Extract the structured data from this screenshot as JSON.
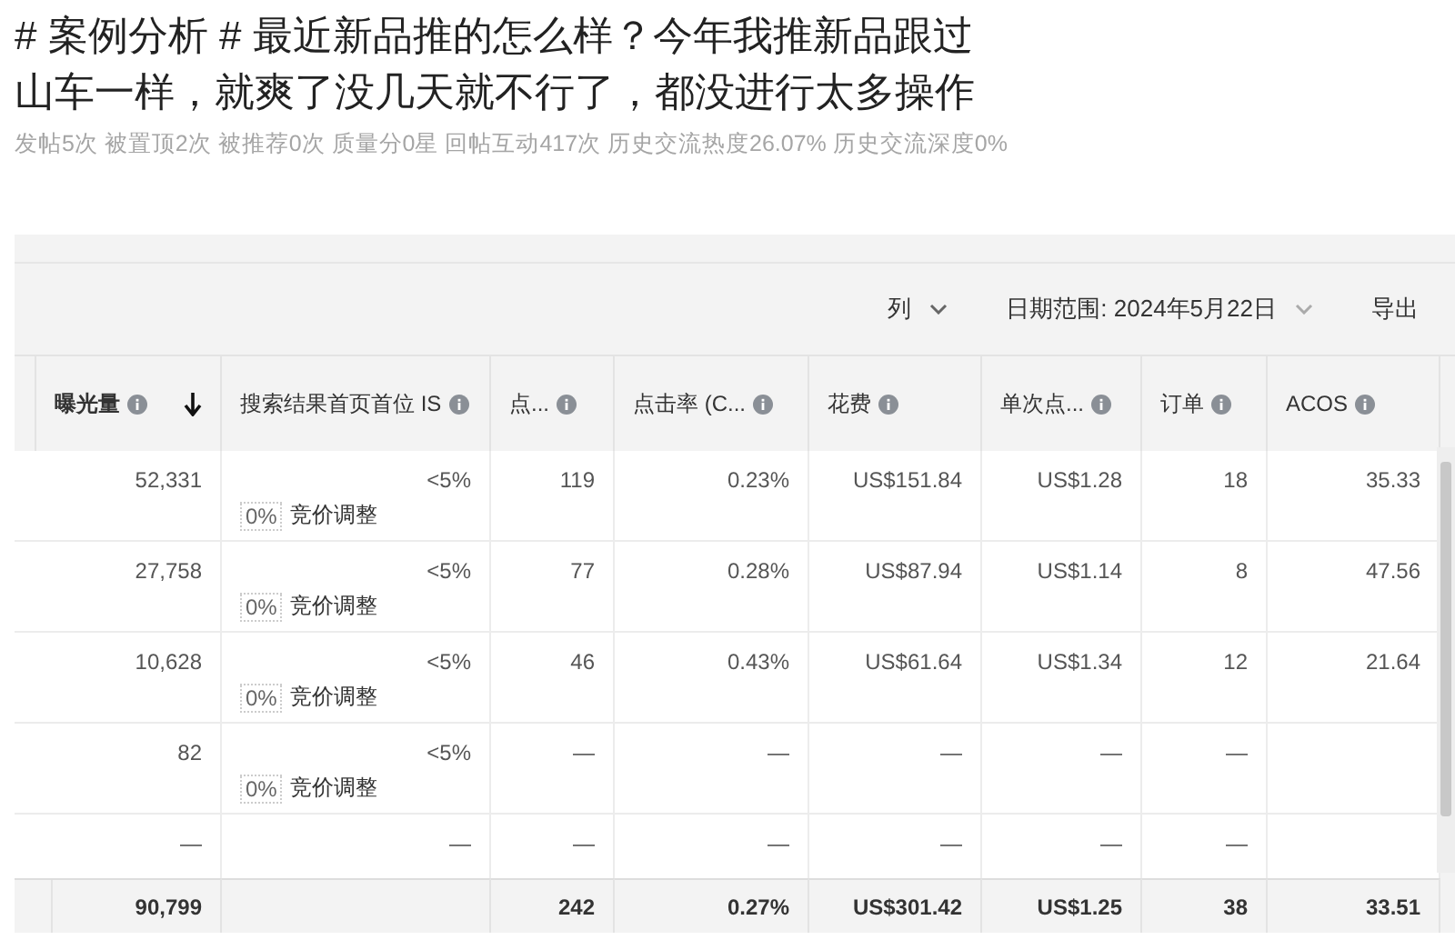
{
  "post": {
    "title_lines": [
      "# 案例分析 # 最近新品推的怎么样？今年我推新品跟过",
      "山车一样，就爽了没几天就不行了，都没进行太多操作"
    ],
    "meta": "发帖5次 被置顶2次 被推荐0次 质量分0星 回帖互动417次 历史交流热度26.07% 历史交流深度0%"
  },
  "toolbar": {
    "columns_button": "列",
    "date_range": "日期范围: 2024年5月22日",
    "export": "导出"
  },
  "table": {
    "columns": [
      {
        "label": "曝光量",
        "sorted": true,
        "kind": "metric"
      },
      {
        "label": "搜索结果首页首位 IS",
        "sorted": false,
        "kind": "share"
      },
      {
        "label": "点...",
        "sorted": false
      },
      {
        "label": "点击率 (C...",
        "sorted": false
      },
      {
        "label": "花费",
        "sorted": false
      },
      {
        "label": "单次点...",
        "sorted": false
      },
      {
        "label": "订单",
        "sorted": false
      },
      {
        "label": "ACOS",
        "sorted": false
      }
    ],
    "rows": [
      {
        "cells": [
          "52,331",
          "<5%",
          "119",
          "0.23%",
          "US$151.84",
          "US$1.28",
          "18",
          "35.33"
        ],
        "bid": {
          "value": "0%",
          "label": "竞价调整"
        }
      },
      {
        "cells": [
          "27,758",
          "<5%",
          "77",
          "0.28%",
          "US$87.94",
          "US$1.14",
          "8",
          "47.56"
        ],
        "bid": {
          "value": "0%",
          "label": "竞价调整"
        }
      },
      {
        "cells": [
          "10,628",
          "<5%",
          "46",
          "0.43%",
          "US$61.64",
          "US$1.34",
          "12",
          "21.64"
        ],
        "bid": {
          "value": "0%",
          "label": "竞价调整"
        }
      },
      {
        "cells": [
          "82",
          "<5%",
          "—",
          "—",
          "—",
          "—",
          "—"
        ],
        "bid": {
          "value": "0%",
          "label": "竞价调整"
        }
      },
      {
        "cells": [
          "—",
          "—",
          "—",
          "—",
          "—",
          "—",
          "—"
        ]
      }
    ],
    "total": [
      "90,799",
      "242",
      "0.27%",
      "US$301.42",
      "US$1.25",
      "38",
      "33.51"
    ]
  }
}
